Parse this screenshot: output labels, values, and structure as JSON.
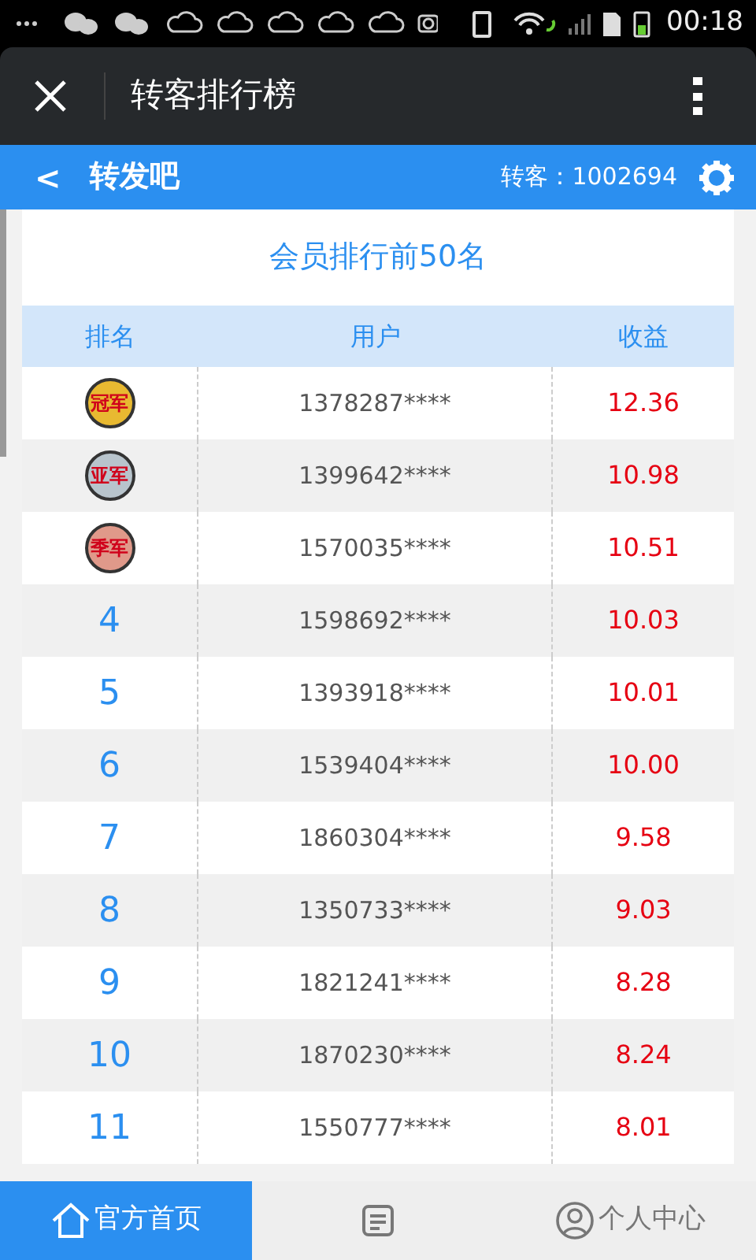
{
  "status_bar": {
    "time": "00:18"
  },
  "title_bar": {
    "title": "转客排行榜"
  },
  "nav_bar": {
    "back": "<",
    "site": "转发吧",
    "count_label": "转客：1002694"
  },
  "heading": "会员排行前50名",
  "table": {
    "columns": [
      "排名",
      "用户",
      "收益"
    ],
    "rows": [
      {
        "kind": "medal",
        "rank": "冠军",
        "color": "#e8b931",
        "user": "1378287****",
        "income": "12.36"
      },
      {
        "kind": "medal",
        "rank": "亚军",
        "color": "#b8c4cc",
        "user": "1399642****",
        "income": "10.98"
      },
      {
        "kind": "medal",
        "rank": "季军",
        "color": "#e0998a",
        "user": "1570035****",
        "income": "10.51"
      },
      {
        "kind": "number",
        "rank": "4",
        "user": "1598692****",
        "income": "10.03"
      },
      {
        "kind": "number",
        "rank": "5",
        "user": "1393918****",
        "income": "10.01"
      },
      {
        "kind": "number",
        "rank": "6",
        "user": "1539404****",
        "income": "10.00"
      },
      {
        "kind": "number",
        "rank": "7",
        "user": "1860304****",
        "income": "9.58"
      },
      {
        "kind": "number",
        "rank": "8",
        "user": "1350733****",
        "income": "9.03"
      },
      {
        "kind": "number",
        "rank": "9",
        "user": "1821241****",
        "income": "8.28"
      },
      {
        "kind": "number",
        "rank": "10",
        "user": "1870230****",
        "income": "8.24"
      },
      {
        "kind": "number",
        "rank": "11",
        "user": "1550777****",
        "income": "8.01"
      }
    ]
  },
  "bottom_tabs": [
    {
      "kind": "home",
      "label": "官方首页",
      "selected": true
    },
    {
      "kind": "middle",
      "selected": false
    },
    {
      "kind": "profile",
      "label": "个人中心",
      "selected": false
    }
  ]
}
